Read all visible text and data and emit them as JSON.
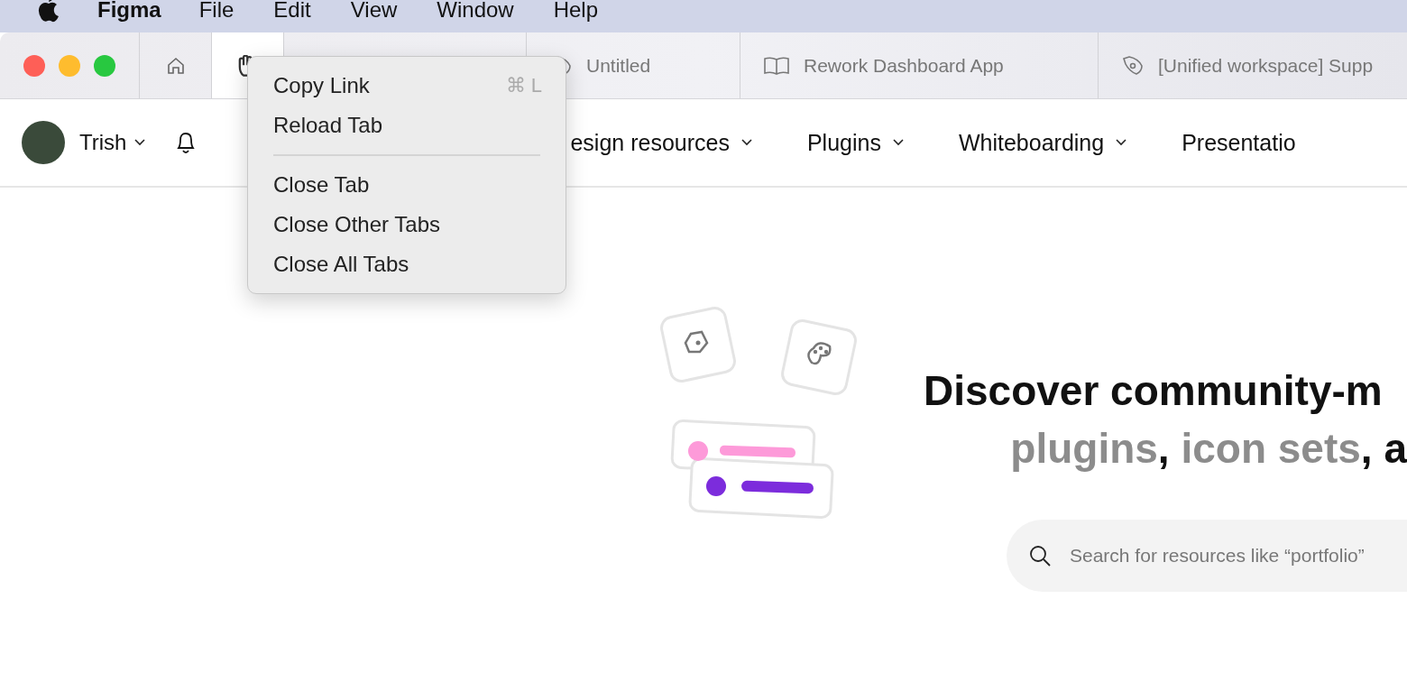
{
  "menubar": {
    "app": "Figma",
    "items": [
      "File",
      "Edit",
      "View",
      "Window",
      "Help"
    ]
  },
  "tabs": [
    {
      "kind": "home",
      "selected": false
    },
    {
      "kind": "community",
      "selected": true
    },
    {
      "kind": "hidden",
      "selected": false
    },
    {
      "kind": "design",
      "title": "Untitled",
      "selected": false
    },
    {
      "kind": "book",
      "title": "Rework Dashboard App",
      "selected": false
    },
    {
      "kind": "design",
      "title": "[Unified workspace] Supp",
      "selected": false
    }
  ],
  "user": {
    "name": "Trish"
  },
  "nav": [
    {
      "label": "esign resources"
    },
    {
      "label": "Plugins"
    },
    {
      "label": "Whiteboarding"
    },
    {
      "label": "Presentatio"
    }
  ],
  "hero": {
    "title": "Discover community-m",
    "subtitle": [
      {
        "kind": "highlight",
        "text": "plugins"
      },
      {
        "kind": "plain",
        "text": ", "
      },
      {
        "kind": "highlight",
        "text": "icon sets"
      },
      {
        "kind": "plain",
        "text": ", a"
      }
    ],
    "search": {
      "placeholder": "Search for resources like “portfolio”"
    }
  },
  "context_menu": [
    {
      "kind": "item",
      "label": "Copy Link",
      "shortcut": "⌘ L"
    },
    {
      "kind": "item",
      "label": "Reload Tab"
    },
    {
      "kind": "separator"
    },
    {
      "kind": "item",
      "label": "Close Tab"
    },
    {
      "kind": "item",
      "label": "Close Other Tabs"
    },
    {
      "kind": "item",
      "label": "Close All Tabs"
    }
  ]
}
